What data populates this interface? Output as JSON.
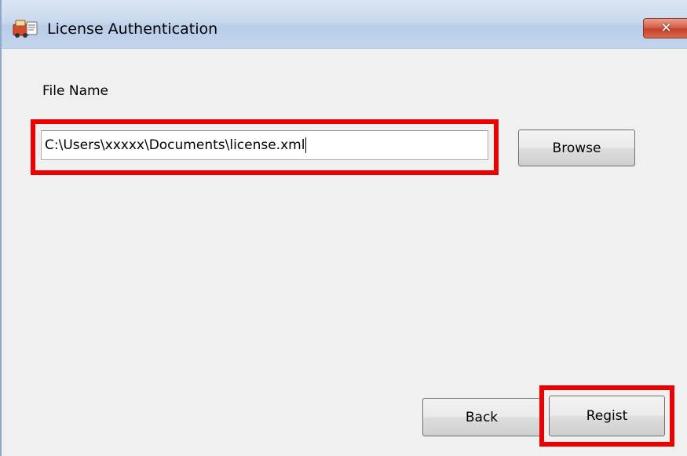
{
  "window": {
    "title": "License Authentication",
    "close_glyph": "✕",
    "app_icon": "license-app-icon"
  },
  "form": {
    "file_name_label": "File Name",
    "file_path_value": "C:\\Users\\xxxxx\\Documents\\license.xml"
  },
  "buttons": {
    "browse": "Browse",
    "back": "Back",
    "regist": "Regist"
  },
  "colors": {
    "highlight": "#ee0000",
    "window_bg": "#f0f0f0",
    "close_button": "#c7402a"
  }
}
